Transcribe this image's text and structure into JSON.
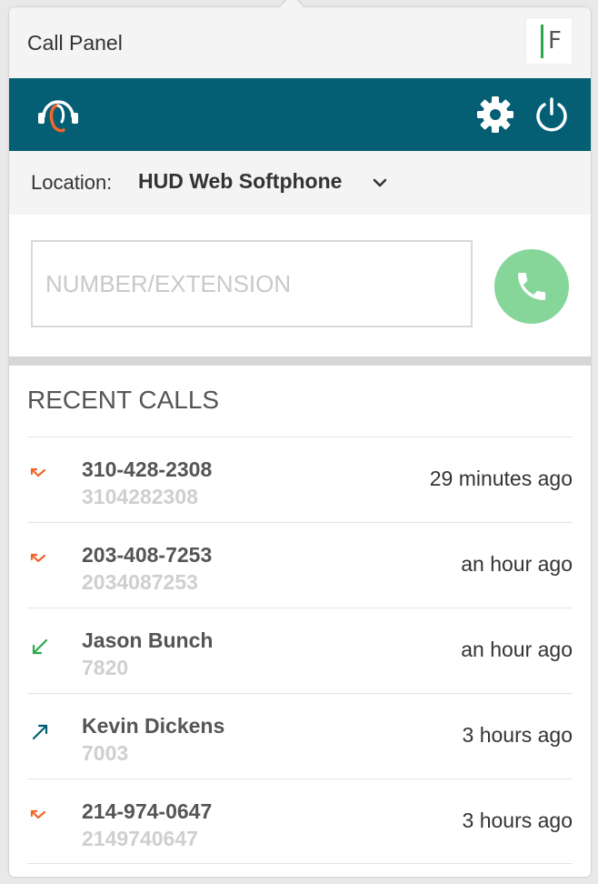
{
  "panel": {
    "title": "Call Panel",
    "logo_letter": "F"
  },
  "toolbar": {
    "icons": [
      "headset-icon",
      "gear-icon",
      "power-icon"
    ],
    "background": "#045e74"
  },
  "location": {
    "label": "Location:",
    "value": "HUD Web Softphone"
  },
  "dialer": {
    "placeholder": "NUMBER/EXTENSION",
    "value": "",
    "call_button_color": "#86d69a"
  },
  "recent_calls": {
    "title": "RECENT CALLS",
    "items": [
      {
        "name": "310-428-2308",
        "sub": "3104282308",
        "time": "29 minutes ago",
        "direction": "missed"
      },
      {
        "name": "203-408-7253",
        "sub": "2034087253",
        "time": "an hour ago",
        "direction": "missed"
      },
      {
        "name": "Jason Bunch",
        "sub": "7820",
        "time": "an hour ago",
        "direction": "incoming"
      },
      {
        "name": "Kevin Dickens",
        "sub": "7003",
        "time": "3 hours ago",
        "direction": "outgoing"
      },
      {
        "name": "214-974-0647",
        "sub": "2149740647",
        "time": "3 hours ago",
        "direction": "missed"
      }
    ]
  },
  "colors": {
    "missed": "#f2662b",
    "incoming": "#2aa84a",
    "outgoing": "#045e74"
  }
}
